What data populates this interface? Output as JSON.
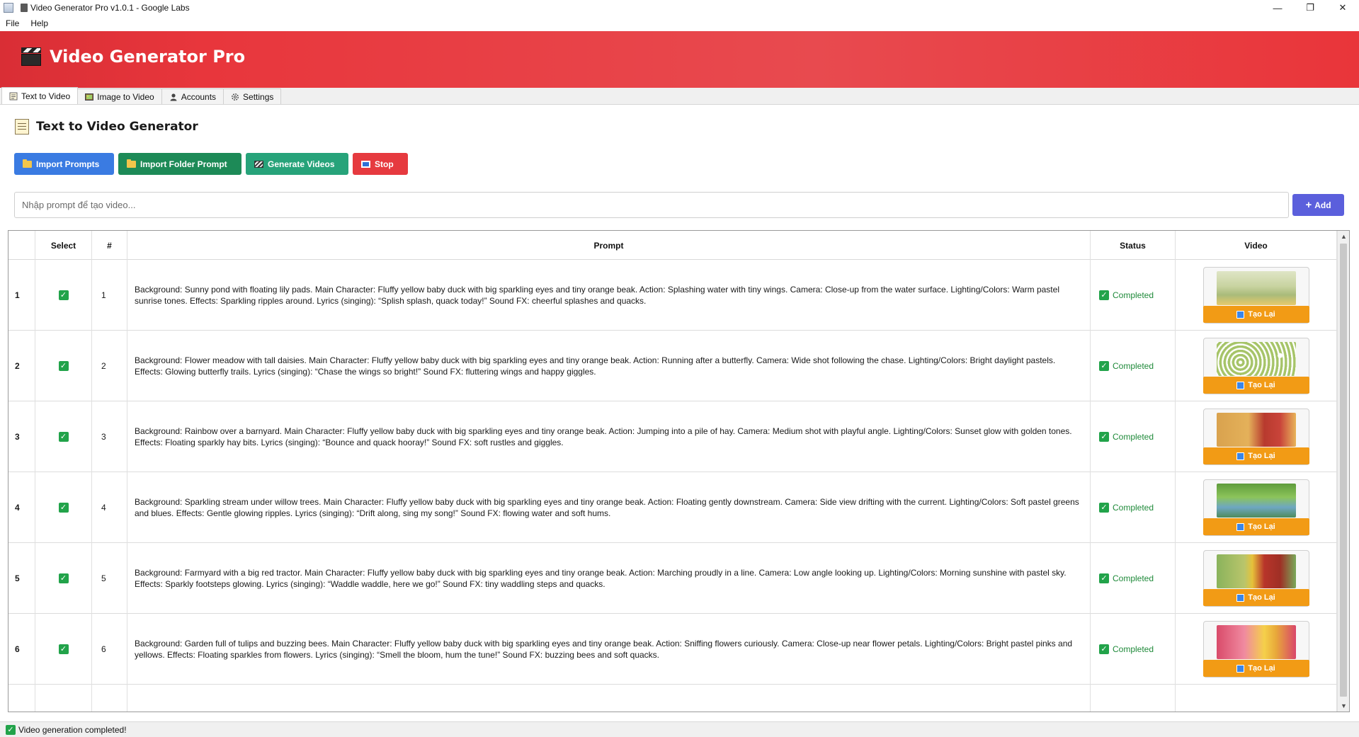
{
  "window": {
    "title": "Video Generator Pro v1.0.1 - Google Labs",
    "controls": {
      "minimize": "—",
      "maximize": "❐",
      "close": "✕"
    }
  },
  "menubar": {
    "items": [
      "File",
      "Help"
    ]
  },
  "header": {
    "brand_title": "Video Generator Pro",
    "brand_icon": "clapperboard-icon"
  },
  "tabs": [
    {
      "label": "Text to Video",
      "icon": "memo-icon",
      "active": true
    },
    {
      "label": "Image to Video",
      "icon": "picture-icon",
      "active": false
    },
    {
      "label": "Accounts",
      "icon": "person-icon",
      "active": false
    },
    {
      "label": "Settings",
      "icon": "gear-icon",
      "active": false
    }
  ],
  "page": {
    "heading": "Text to Video Generator",
    "buttons": {
      "import_prompts": "Import Prompts",
      "import_folder": "Import Folder Prompt",
      "generate": "Generate Videos",
      "stop": "Stop"
    },
    "prompt_input": {
      "placeholder": "Nhập prompt để tạo video...",
      "value": ""
    },
    "add_button": "Add"
  },
  "table": {
    "columns": [
      "Select",
      "#",
      "Prompt",
      "Status",
      "Video"
    ],
    "retry_label": "Tạo Lại",
    "rows": [
      {
        "index": "1",
        "num": "1",
        "selected": true,
        "status": "Completed",
        "prompt": "Background: Sunny pond with floating lily pads. Main Character: Fluffy yellow baby duck with big sparkling eyes and tiny orange beak. Action: Splashing water with tiny wings. Camera: Close-up from the water surface. Lighting/Colors: Warm pastel sunrise tones. Effects: Sparkling ripples around. Lyrics (singing): “Splish splash, quack today!” Sound FX: cheerful splashes and quacks."
      },
      {
        "index": "2",
        "num": "2",
        "selected": true,
        "status": "Completed",
        "prompt": "Background: Flower meadow with tall daisies. Main Character: Fluffy yellow baby duck with big sparkling eyes and tiny orange beak. Action: Running after a butterfly. Camera: Wide shot following the chase. Lighting/Colors: Bright daylight pastels. Effects: Glowing butterfly trails. Lyrics (singing): “Chase the wings so bright!” Sound FX: fluttering wings and happy giggles."
      },
      {
        "index": "3",
        "num": "3",
        "selected": true,
        "status": "Completed",
        "prompt": "Background: Rainbow over a barnyard. Main Character: Fluffy yellow baby duck with big sparkling eyes and tiny orange beak. Action: Jumping into a pile of hay. Camera: Medium shot with playful angle. Lighting/Colors: Sunset glow with golden tones. Effects: Floating sparkly hay bits. Lyrics (singing): “Bounce and quack hooray!” Sound FX: soft rustles and giggles."
      },
      {
        "index": "4",
        "num": "4",
        "selected": true,
        "status": "Completed",
        "prompt": "Background: Sparkling stream under willow trees. Main Character: Fluffy yellow baby duck with big sparkling eyes and tiny orange beak. Action: Floating gently downstream. Camera: Side view drifting with the current. Lighting/Colors: Soft pastel greens and blues. Effects: Gentle glowing ripples. Lyrics (singing): “Drift along, sing my song!” Sound FX: flowing water and soft hums."
      },
      {
        "index": "5",
        "num": "5",
        "selected": true,
        "status": "Completed",
        "prompt": "Background: Farmyard with a big red tractor. Main Character: Fluffy yellow baby duck with big sparkling eyes and tiny orange beak. Action: Marching proudly in a line. Camera: Low angle looking up. Lighting/Colors: Morning sunshine with pastel sky. Effects: Sparkly footsteps glowing. Lyrics (singing): “Waddle waddle, here we go!” Sound FX: tiny waddling steps and quacks."
      },
      {
        "index": "6",
        "num": "6",
        "selected": true,
        "status": "Completed",
        "prompt": "Background: Garden full of tulips and buzzing bees. Main Character: Fluffy yellow baby duck with big sparkling eyes and tiny orange beak. Action: Sniffing flowers curiously. Camera: Close-up near flower petals. Lighting/Colors: Bright pastel pinks and yellows. Effects: Floating sparkles from flowers. Lyrics (singing): “Smell the bloom, hum the tune!” Sound FX: buzzing bees and soft quacks."
      }
    ]
  },
  "statusbar": {
    "message": "Video generation completed!"
  },
  "colors": {
    "banner": "#e8363c",
    "import_prompts": "#3a7be2",
    "import_folder": "#1d8a57",
    "generate": "#27a37a",
    "stop": "#e63a3f",
    "add": "#5b5fdc",
    "retry": "#f29b15",
    "completed": "#1f8a3a"
  }
}
